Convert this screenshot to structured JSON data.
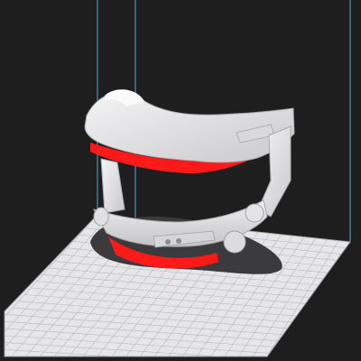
{
  "viewport": {
    "background_color": "#1e1e1f",
    "build_plate": {
      "color": "#e6e6e8",
      "grid_color": "#b9b9bd",
      "edge_color": "#9aa0a8"
    },
    "build_volume_line_color": "#5aa6d6",
    "model": {
      "name_icon": "face-mask-model",
      "body_color": "#e9e9ea",
      "shade_color": "#bdbdc0",
      "overhang_highlight_color": "#ff1a1a",
      "shadow_color": "#3b3b3d"
    }
  }
}
